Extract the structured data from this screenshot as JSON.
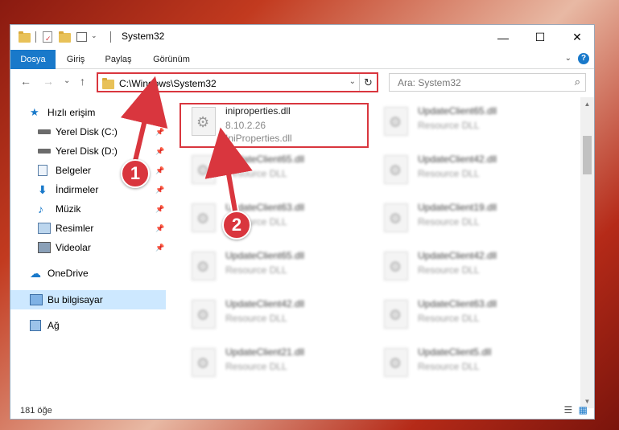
{
  "window": {
    "title": "System32",
    "controls": {
      "minimize": "—",
      "maximize": "☐",
      "close": "✕"
    }
  },
  "ribbon": {
    "tabs": [
      {
        "label": "Dosya",
        "active": true
      },
      {
        "label": "Giriş",
        "active": false
      },
      {
        "label": "Paylaş",
        "active": false
      },
      {
        "label": "Görünüm",
        "active": false
      }
    ],
    "help": "?",
    "collapse": "⌄"
  },
  "address": {
    "path": "C:\\Windows\\System32",
    "dropdown": "⌄",
    "refresh": "↻"
  },
  "search": {
    "placeholder": "Ara: System32",
    "icon": "⌕"
  },
  "nav_buttons": {
    "back": "←",
    "forward": "→",
    "recent": "⌄",
    "up": "↑"
  },
  "sidebar": {
    "items": [
      {
        "label": "Hızlı erişim",
        "icon": "star-icon",
        "pinned": false
      },
      {
        "label": "Yerel Disk (C:)",
        "icon": "drive-icon",
        "pinned": true
      },
      {
        "label": "Yerel Disk (D:)",
        "icon": "drive-icon",
        "pinned": true
      },
      {
        "label": "Belgeler",
        "icon": "documents-icon",
        "pinned": true
      },
      {
        "label": "İndirmeler",
        "icon": "download-icon",
        "pinned": true
      },
      {
        "label": "Müzik",
        "icon": "music-icon",
        "pinned": true
      },
      {
        "label": "Resimler",
        "icon": "pictures-icon",
        "pinned": true
      },
      {
        "label": "Videolar",
        "icon": "videos-icon",
        "pinned": true
      },
      {
        "label": "OneDrive",
        "icon": "cloud-icon",
        "pinned": false
      },
      {
        "label": "Bu bilgisayar",
        "icon": "computer-icon",
        "pinned": false
      },
      {
        "label": "Ağ",
        "icon": "network-icon",
        "pinned": false
      }
    ],
    "pin_glyph": "📌"
  },
  "files": {
    "highlighted": {
      "name": "iniproperties.dll",
      "version": "8.10.2.26",
      "description": "IniProperties.dll"
    },
    "others": [
      {
        "name": "UpdateClient65.dll",
        "type": "Resource DLL"
      },
      {
        "name": "UpdateClient65.dll",
        "type": "Resource DLL"
      },
      {
        "name": "UpdateClient42.dll",
        "type": "Resource DLL"
      },
      {
        "name": "UpdateClient63.dll",
        "type": "Resource DLL"
      },
      {
        "name": "UpdateClient19.dll",
        "type": "Resource DLL"
      },
      {
        "name": "UpdateClient65.dll",
        "type": "Resource DLL"
      },
      {
        "name": "UpdateClient42.dll",
        "type": "Resource DLL"
      },
      {
        "name": "UpdateClient42.dll",
        "type": "Resource DLL"
      },
      {
        "name": "UpdateClient63.dll",
        "type": "Resource DLL"
      },
      {
        "name": "UpdateClient21.dll",
        "type": "Resource DLL"
      },
      {
        "name": "UpdateClient5.dll",
        "type": "Resource DLL"
      }
    ]
  },
  "status": {
    "count": "181 öğe"
  },
  "annotations": {
    "step1": "1",
    "step2": "2"
  },
  "colors": {
    "accent": "#1979ca",
    "highlight": "#d9363e",
    "selected": "#cde8ff"
  }
}
